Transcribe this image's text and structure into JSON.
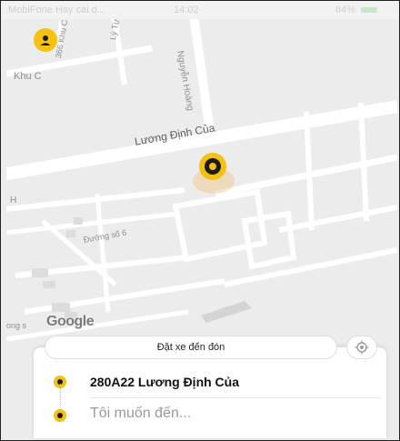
{
  "status_bar": {
    "carrier": "MobiFone Hay cai d...",
    "time": "14:02",
    "battery": "84%"
  },
  "map": {
    "labels": {
      "khu_c": "Khu C",
      "street_366": "366 Khu C",
      "ly_thien": "Lý Tự Hàn",
      "nguyen_hoang": "Nguyễn Hoàng",
      "luong_dinh_cua": "Lương Định Của",
      "duong_so_6": "Đường số 6",
      "left_cut_1": "H",
      "left_cut_2": "ong s"
    },
    "attribution": "Google"
  },
  "booking": {
    "pickup_button": "Đặt xe đến đón",
    "pickup_address": "280A22 Lương Định Của",
    "destination_placeholder": "Tôi muốn đến..."
  },
  "colors": {
    "accent": "#f4c012",
    "dark": "#1b1b1b",
    "map_bg": "#ececec",
    "road": "#ffffff"
  }
}
